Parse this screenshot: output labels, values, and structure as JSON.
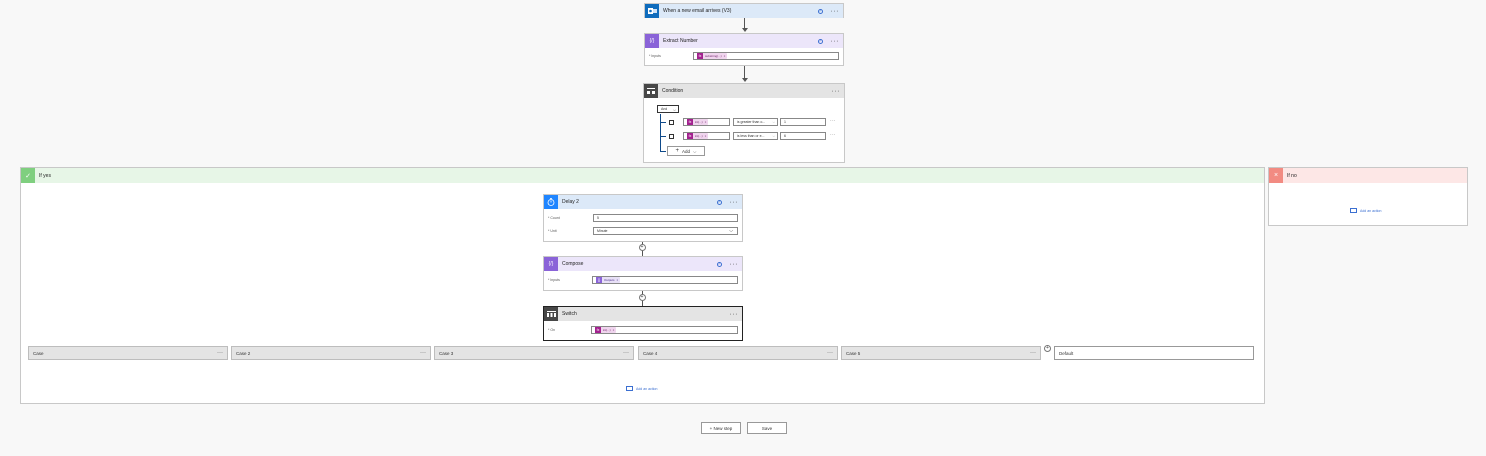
{
  "trigger": {
    "title": "When a new email arrives (V3)",
    "help": "?",
    "more": "···"
  },
  "extract": {
    "title": "Extract Number",
    "help": "?",
    "more": "···",
    "inputs_label": "* Inputs",
    "token": "substring(...)",
    "token_x": "×"
  },
  "condition": {
    "title": "Condition",
    "more": "···",
    "group": "And",
    "rows": [
      {
        "token": "int(...)",
        "operator": "is greater than o...",
        "value": "1"
      },
      {
        "token": "int(...)",
        "operator": "is less than or e...",
        "value": "6"
      }
    ],
    "add_label": "Add",
    "row_more": "···"
  },
  "if_yes": {
    "label": "If yes"
  },
  "if_no": {
    "label": "If no",
    "add_action": "Add an action"
  },
  "delay": {
    "title": "Delay 2",
    "help": "?",
    "more": "···",
    "count_label": "* Count",
    "count_value": "5",
    "unit_label": "* Unit",
    "unit_value": "Minute"
  },
  "compose": {
    "title": "Compose",
    "help": "?",
    "more": "···",
    "inputs_label": "* Inputs",
    "token": "Outputs",
    "token_x": "×"
  },
  "switch": {
    "title": "Switch",
    "more": "···",
    "on_label": "* On",
    "token": "int(...)",
    "token_x": "×"
  },
  "cases": [
    {
      "label": "Case",
      "more": "···"
    },
    {
      "label": "Case 2",
      "more": "···"
    },
    {
      "label": "Case 3",
      "more": "···"
    },
    {
      "label": "Case 4",
      "more": "···"
    },
    {
      "label": "Case 5",
      "more": "···"
    }
  ],
  "default_case": {
    "label": "Default"
  },
  "add_case": "+",
  "yes_add_action": "Add an action",
  "footer": {
    "new_step": "+ New step",
    "save": "Save"
  },
  "colors": {
    "outlook": "#0f6cbd",
    "expression": "#8a63d8",
    "condition": "#474747",
    "delay": "#1f85ff",
    "yes": "#7fcf7f",
    "no": "#f28b82"
  }
}
